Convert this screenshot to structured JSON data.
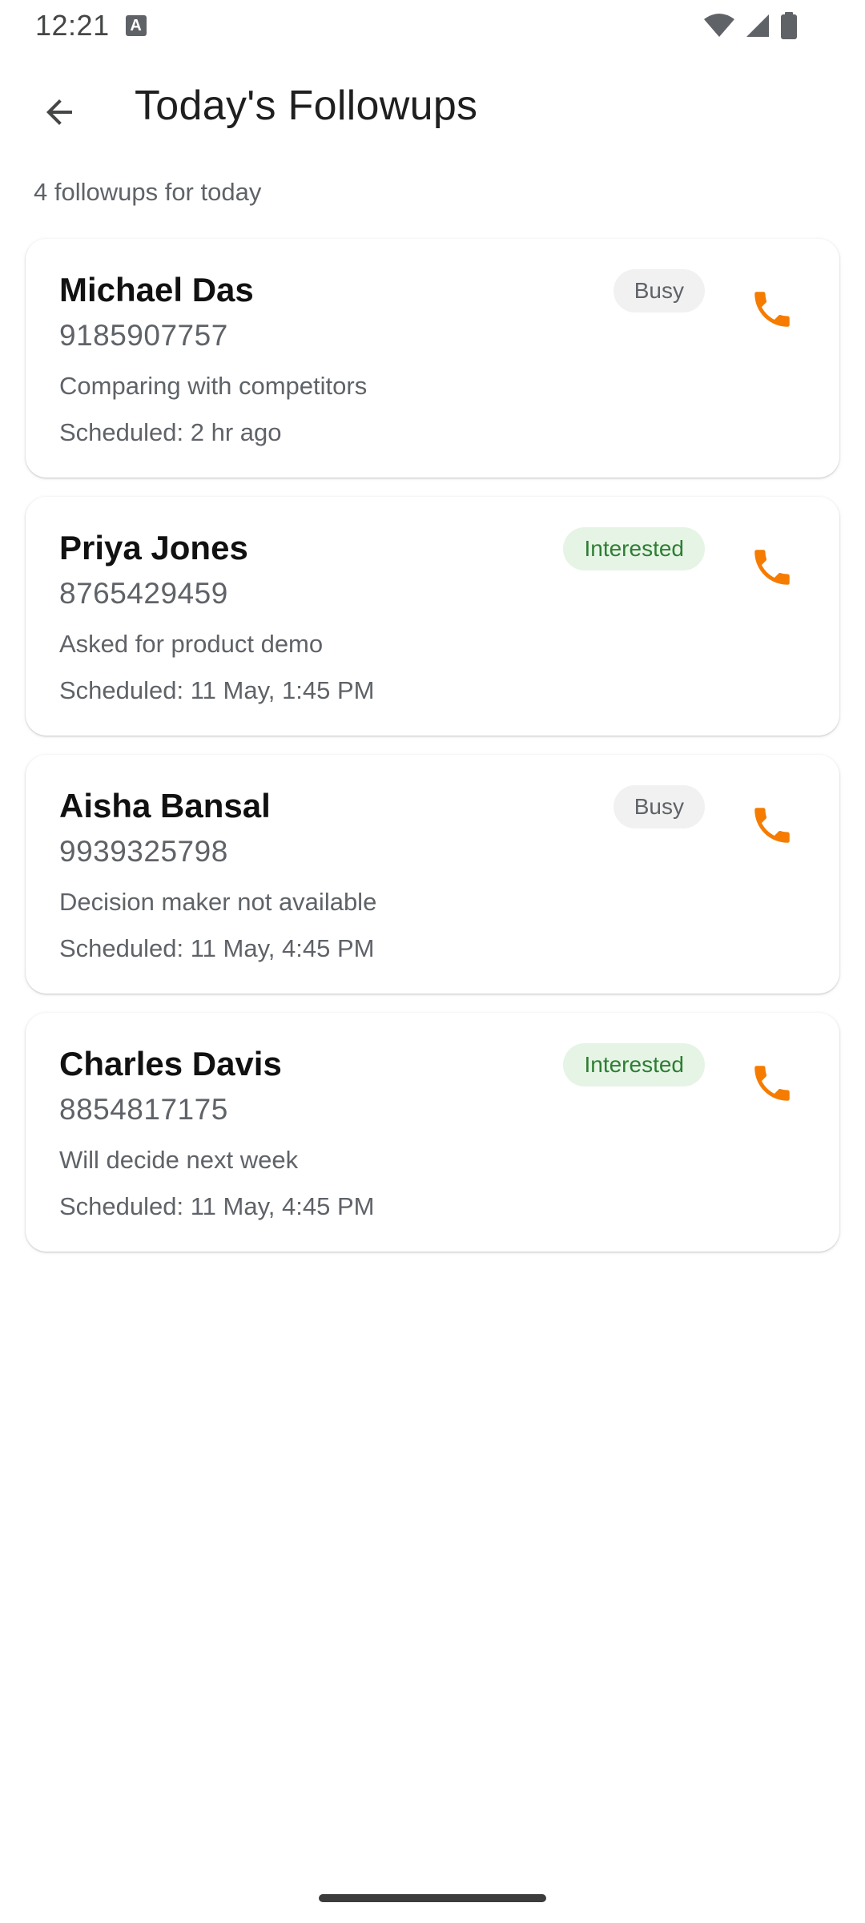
{
  "status_bar": {
    "time": "12:21",
    "notification_letter": "A"
  },
  "header": {
    "title": "Today's Followups"
  },
  "summary": "4 followups for today",
  "colors": {
    "call_icon": "#f57c00",
    "busy_badge_bg": "#f1f1f1",
    "interested_badge_bg": "#e6f4e6",
    "interested_text": "#2e7d32"
  },
  "followups": [
    {
      "name": "Michael Das",
      "phone": "9185907757",
      "status": "Busy",
      "note": "Comparing with competitors",
      "scheduled": "Scheduled: 2 hr ago"
    },
    {
      "name": "Priya Jones",
      "phone": "8765429459",
      "status": "Interested",
      "note": "Asked for product demo",
      "scheduled": "Scheduled: 11 May, 1:45 PM"
    },
    {
      "name": "Aisha Bansal",
      "phone": "9939325798",
      "status": "Busy",
      "note": "Decision maker not available",
      "scheduled": "Scheduled: 11 May, 4:45 PM"
    },
    {
      "name": "Charles Davis",
      "phone": "8854817175",
      "status": "Interested",
      "note": "Will decide next week",
      "scheduled": "Scheduled: 11 May, 4:45 PM"
    }
  ]
}
